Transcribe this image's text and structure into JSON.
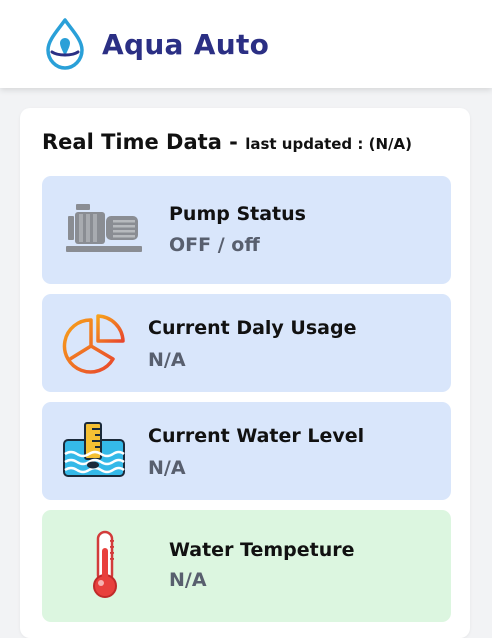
{
  "app": {
    "title": "Aqua Auto",
    "logo_icon": "water-drop-icon",
    "brand_color": "#2b2f84",
    "accent_color": "#2aa0d8"
  },
  "realtime": {
    "title": "Real Time Data -",
    "updated_label": "last updated : (N/A)"
  },
  "cards": [
    {
      "icon": "pump-icon",
      "label": "Pump Status",
      "value": "OFF / off",
      "background": "#d9e6fb"
    },
    {
      "icon": "pie-chart-icon",
      "label": "Current Daly Usage",
      "value": "N/A",
      "background": "#d9e6fb"
    },
    {
      "icon": "water-level-icon",
      "label": "Current Water Level",
      "value": "N/A",
      "background": "#d9e6fb"
    },
    {
      "icon": "thermometer-icon",
      "label": "Water Tempeture",
      "value": "N/A",
      "background": "#dcf6e0"
    }
  ]
}
